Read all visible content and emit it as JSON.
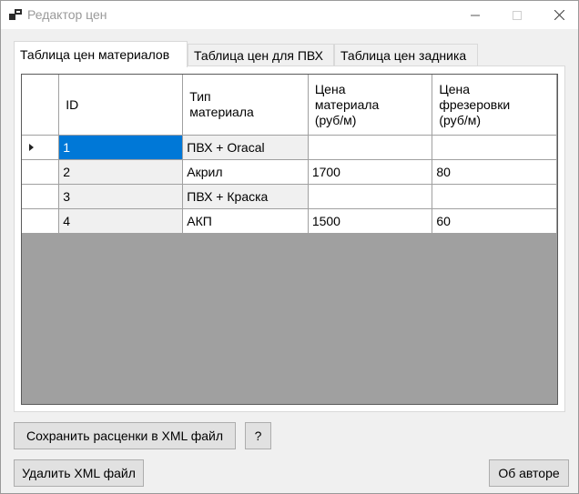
{
  "window": {
    "title": "Редактор цен"
  },
  "tabs": [
    {
      "label": "Таблица цен материалов"
    },
    {
      "label": "Таблица цен для ПВХ"
    },
    {
      "label": "Таблица цен задника"
    }
  ],
  "grid": {
    "columns": [
      {
        "lines": [
          "ID"
        ]
      },
      {
        "lines": [
          "Тип",
          "материала"
        ]
      },
      {
        "lines": [
          "Цена",
          "материала",
          "(руб/м)"
        ]
      },
      {
        "lines": [
          "Цена",
          "фрезеровки",
          "(руб/м)"
        ]
      }
    ],
    "rows": [
      {
        "id": "1",
        "type": "ПВХ + Oracal",
        "material_price": "",
        "milling_price": ""
      },
      {
        "id": "2",
        "type": "Акрил",
        "material_price": "1700",
        "milling_price": "80"
      },
      {
        "id": "3",
        "type": "ПВХ + Краска",
        "material_price": "",
        "milling_price": ""
      },
      {
        "id": "4",
        "type": "АКП",
        "material_price": "1500",
        "milling_price": "60"
      }
    ]
  },
  "buttons": {
    "save_xml": "Сохранить расценки в XML файл",
    "help": "?",
    "delete_xml": "Удалить XML файл",
    "about": "Об авторе"
  },
  "colors": {
    "selection": "#0078d7",
    "grid_background": "#a0a0a0",
    "title_text": "#9a9a9a"
  }
}
